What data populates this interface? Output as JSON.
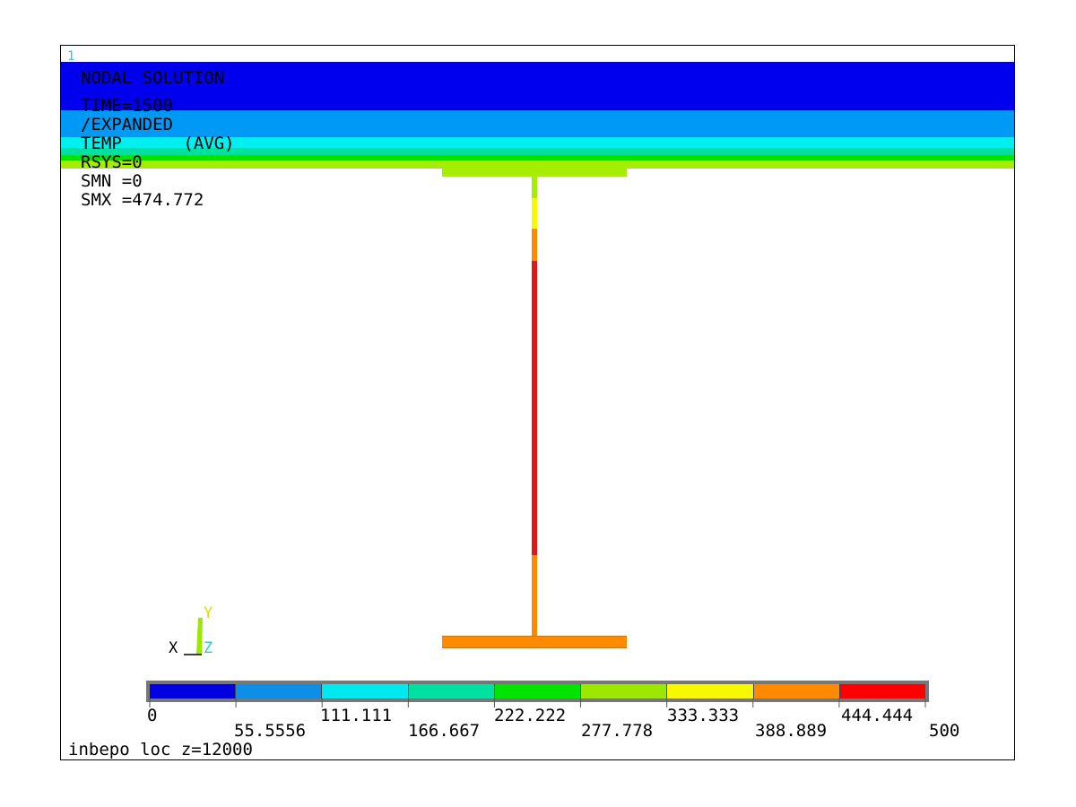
{
  "window_number": "1",
  "info": {
    "line1": "NODAL SOLUTION",
    "line2": "TIME=1500",
    "line3": "/EXPANDED",
    "line4": "TEMP      (AVG)",
    "line5": "RSYS=0",
    "line6": "SMN =0",
    "line7": "SMX =474.772"
  },
  "footer_text": "inbepo loc z=12000",
  "triad": {
    "x": "X",
    "y": "Y",
    "z": "Z"
  },
  "legend": {
    "colors": [
      "#0000e0",
      "#0d8fe8",
      "#00e9f0",
      "#00e0a0",
      "#00e400",
      "#9de800",
      "#f8f800",
      "#ff8a00",
      "#ff0000"
    ],
    "top_labels": [
      "0",
      "111.111",
      "222.222",
      "333.333",
      "444.444"
    ],
    "bottom_labels": [
      "55.5556",
      "166.667",
      "277.778",
      "388.889",
      "500"
    ]
  },
  "colors": {
    "slab_dark_blue": "#0000ee",
    "slab_blue": "#0099f5",
    "slab_cyan": "#00f0f0",
    "slab_green": "#00e400",
    "slab_yellow_green": "#a6ee00",
    "web_red": "#e41515",
    "web_orange": "#ff8a00",
    "web_yellow": "#f8f800",
    "bottom_flange": "#ff8a00"
  }
}
